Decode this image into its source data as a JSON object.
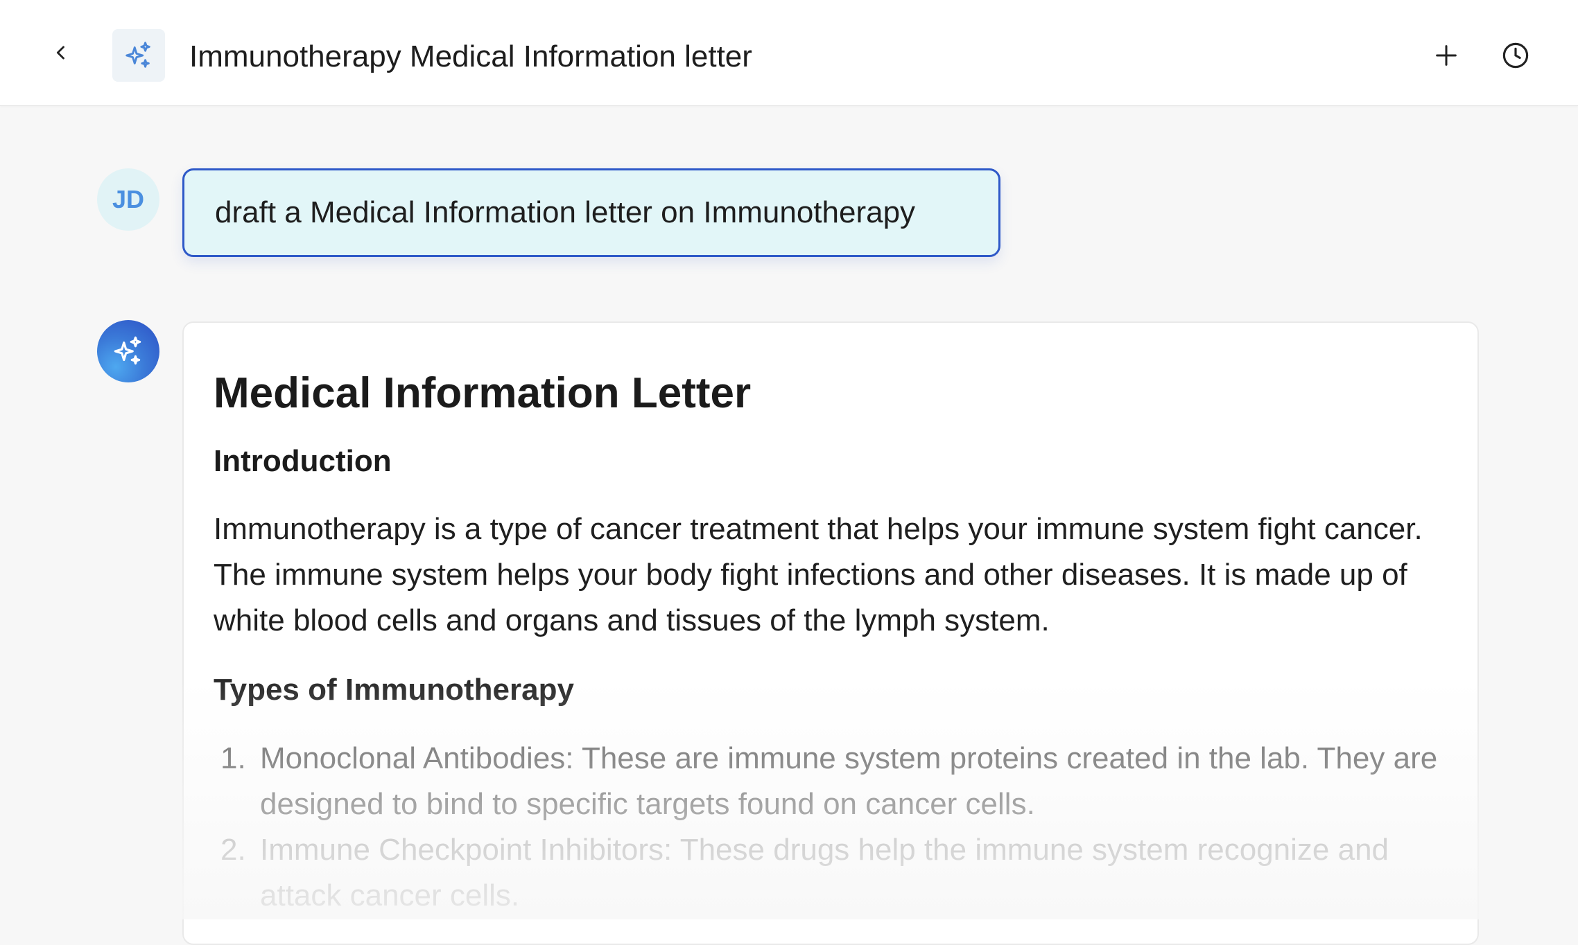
{
  "header": {
    "back_icon": "chevron-left-icon",
    "app_icon": "sparkles-icon",
    "title": "Immunotherapy Medical Information letter",
    "new_icon": "plus-icon",
    "history_icon": "clock-icon"
  },
  "user": {
    "initials": "JD"
  },
  "prompt": {
    "text": "draft a Medical Information letter on Immunotherapy"
  },
  "response": {
    "avatar_icon": "sparkles-icon",
    "title": "Medical Information Letter",
    "intro_heading": "Introduction",
    "intro_text": "Immunotherapy is a type of cancer treatment that helps your immune system fight cancer. The immune system helps your body fight infections and other diseases. It is made up of white blood cells and organs and tissues of the lymph system.",
    "types_heading": "Types of Immunotherapy",
    "types": [
      {
        "number": "1.",
        "text": "Monoclonal Antibodies: These are immune system proteins created in the lab. They are designed to bind to specific targets found on cancer cells."
      },
      {
        "number": "2.",
        "text": "Immune Checkpoint Inhibitors: These drugs help the immune system recognize and attack cancer cells."
      }
    ]
  },
  "colors": {
    "accent": "#2e59c8",
    "prompt_bg": "#e2f6f8",
    "avatar_text": "#4a8fe0",
    "page_bg": "#f7f7f7"
  }
}
